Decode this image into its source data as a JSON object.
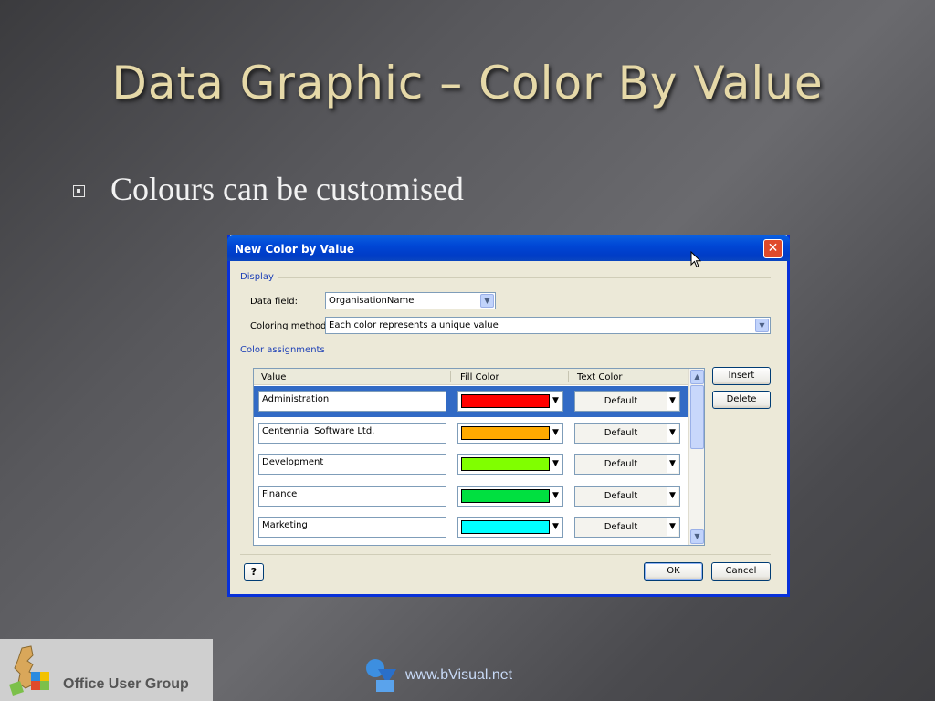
{
  "slide": {
    "title": "Data Graphic – Color By Value",
    "bullet": "Colours can be customised"
  },
  "dialog": {
    "title": "New Color by Value",
    "display_section": "Display",
    "data_field_label": "Data field:",
    "data_field_value": "OrganisationName",
    "coloring_method_label": "Coloring method:",
    "coloring_method_value": "Each color represents a unique value",
    "assignments_section": "Color assignments",
    "columns": [
      "Value",
      "Fill Color",
      "Text Color"
    ],
    "rows": [
      {
        "value": "Administration",
        "fill": "#ff0000",
        "text_color": "Default",
        "selected": true
      },
      {
        "value": "Centennial Software Ltd.",
        "fill": "#ffaa00",
        "text_color": "Default",
        "selected": false
      },
      {
        "value": "Development",
        "fill": "#80ff00",
        "text_color": "Default",
        "selected": false
      },
      {
        "value": "Finance",
        "fill": "#00e040",
        "text_color": "Default",
        "selected": false
      },
      {
        "value": "Marketing",
        "fill": "#00ffff",
        "text_color": "Default",
        "selected": false
      }
    ],
    "insert_label": "Insert",
    "delete_label": "Delete",
    "ok_label": "OK",
    "cancel_label": "Cancel",
    "help_label": "?"
  },
  "footer": {
    "org": "Office User Group",
    "url": "www.bVisual.net"
  }
}
